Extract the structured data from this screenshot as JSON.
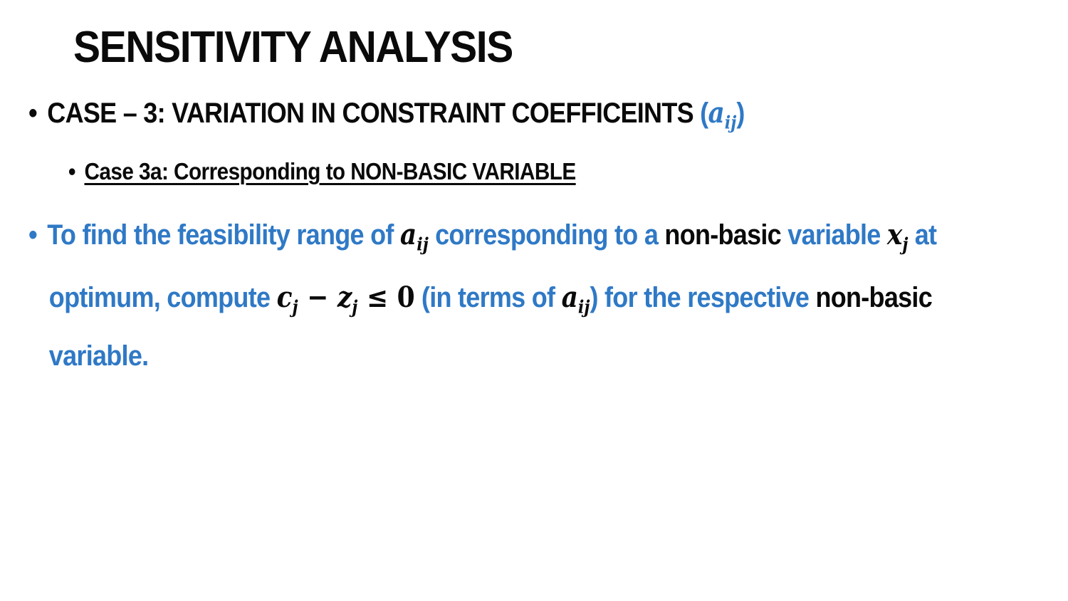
{
  "slide": {
    "title": "SENSITIVITY ANALYSIS",
    "bullet_symbol": "•",
    "case": {
      "text": "CASE – 3: VARIATION IN CONSTRAINT COEFFICEINTS ",
      "paren_open": "(",
      "math_var": "a",
      "math_sub": "ij",
      "paren_close": ")"
    },
    "subcase": {
      "text": "Case 3a: Corresponding to NON-BASIC VARIABLE"
    },
    "paragraph": {
      "line1_a": "To find the feasibility range of ",
      "line1_math_var": "a",
      "line1_math_sub": "ij",
      "line1_b": " corresponding to a ",
      "line1_c": "non-basic",
      "line1_d": " variable ",
      "line1_math2_var": "x",
      "line1_math2_sub": "j",
      "line1_e": " at",
      "line2_a": "optimum, compute ",
      "line2_math_c": "c",
      "line2_math_c_sub": "j",
      "line2_math_minus": " − ",
      "line2_math_z": "z",
      "line2_math_z_sub": "j",
      "line2_math_leq": " ≤ ",
      "line2_math_zero": "0",
      "line2_b": " (in terms of ",
      "line2_math3_var": "a",
      "line2_math3_sub": "ij",
      "line2_c": ") for the respective ",
      "line2_d": "non-basic",
      "line3": "variable."
    },
    "colors": {
      "accent_blue": "#2f79c6",
      "text_black": "#0a0a0a",
      "background": "#ffffff"
    }
  }
}
